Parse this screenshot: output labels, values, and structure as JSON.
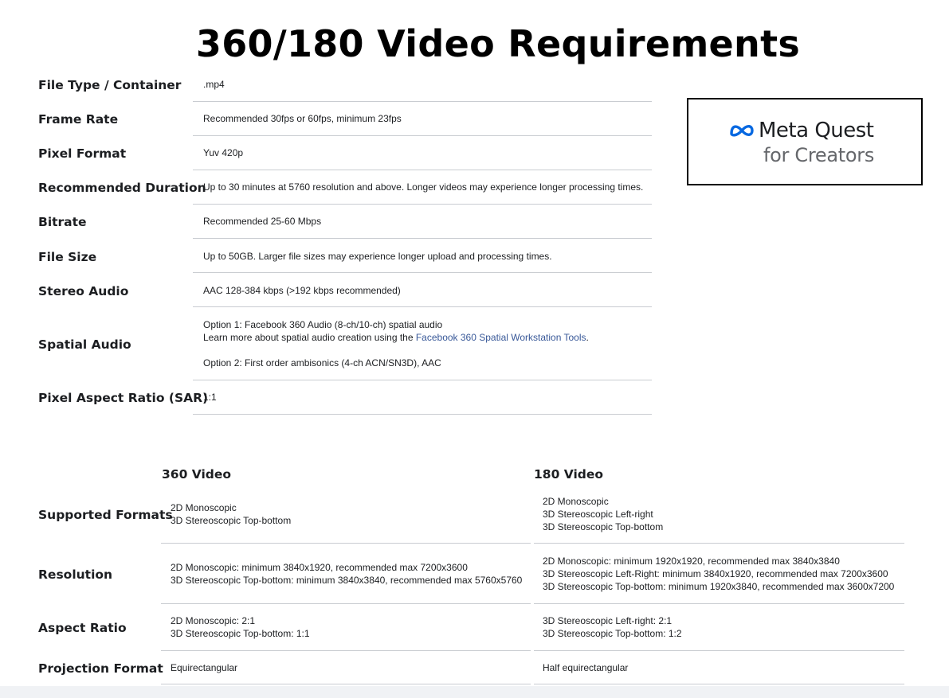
{
  "title": "360/180 Video Requirements",
  "logo": {
    "name": "Meta Quest",
    "sub": "for Creators",
    "brand_color": "#0668E1"
  },
  "specs": [
    {
      "label": "File Type / Container",
      "lines": [
        ".mp4"
      ]
    },
    {
      "label": "Frame Rate",
      "lines": [
        "Recommended 30fps or 60fps, minimum 23fps"
      ]
    },
    {
      "label": "Pixel Format",
      "lines": [
        "Yuv 420p"
      ]
    },
    {
      "label": "Recommended Duration",
      "lines": [
        "Up to 30 minutes at 5760 resolution and above. Longer videos may experience longer processing times."
      ]
    },
    {
      "label": "Bitrate",
      "lines": [
        "Recommended 25-60 Mbps"
      ]
    },
    {
      "label": "File Size",
      "lines": [
        "Up to 50GB. Larger file sizes may experience longer upload and processing times."
      ]
    },
    {
      "label": "Stereo Audio",
      "lines": [
        "AAC 128-384 kbps (>192 kbps recommended)"
      ]
    },
    {
      "label": "Spatial Audio",
      "line1": "Option 1: Facebook 360 Audio (8-ch/10-ch) spatial audio",
      "line2_prefix": "Learn more about spatial audio creation using the ",
      "line2_link": "Facebook 360 Spatial Workstation Tools",
      "line2_suffix": ".",
      "line3": "Option 2: First order ambisonics (4-ch ACN/SN3D), AAC"
    },
    {
      "label": "Pixel Aspect Ratio (SAR)",
      "lines": [
        "1:1"
      ]
    }
  ],
  "formats": {
    "col360": "360 Video",
    "col180": "180 Video",
    "rows": [
      {
        "label": "Supported Formats",
        "v360": [
          "2D Monoscopic",
          "3D Stereoscopic Top-bottom"
        ],
        "v180": [
          "2D Monoscopic",
          "3D Stereoscopic Left-right",
          "3D Stereoscopic Top-bottom"
        ]
      },
      {
        "label": "Resolution",
        "v360": [
          "2D Monoscopic: minimum 3840x1920, recommended max 7200x3600",
          "3D Stereoscopic Top-bottom: minimum 3840x3840, recommended max 5760x5760"
        ],
        "v180": [
          "2D Monoscopic: minimum 1920x1920, recommended max 3840x3840",
          "3D Stereoscopic Left-Right: minimum 3840x1920, recommended max 7200x3600",
          "3D Stereoscopic Top-bottom: minimum 1920x3840, recommended max 3600x7200"
        ]
      },
      {
        "label": "Aspect Ratio",
        "v360": [
          "2D Monoscopic: 2:1",
          "3D Stereoscopic Top-bottom: 1:1"
        ],
        "v180": [
          "3D Stereoscopic Left-right: 2:1",
          "3D Stereoscopic Top-bottom: 1:2"
        ]
      },
      {
        "label": "Projection Format",
        "v360": [
          "Equirectangular"
        ],
        "v180": [
          "Half equirectangular"
        ]
      }
    ]
  }
}
